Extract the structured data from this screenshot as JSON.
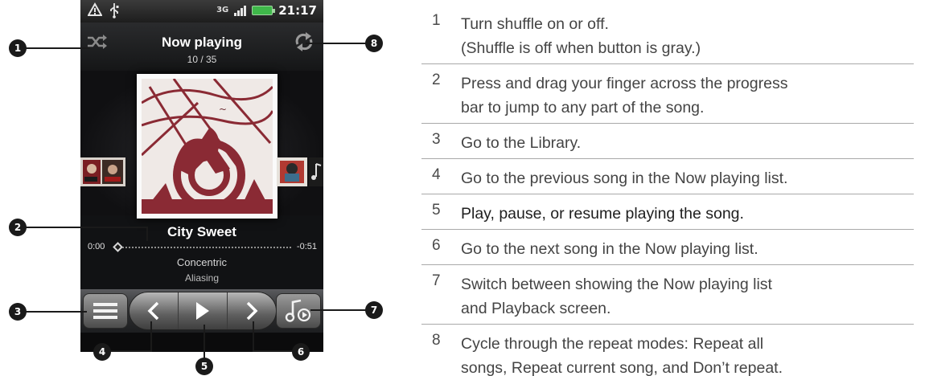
{
  "status_bar": {
    "network": "3G",
    "time": "21:17"
  },
  "player": {
    "header_title": "Now playing",
    "track_position": "10 / 35",
    "song_title": "City Sweet",
    "time_elapsed": "0:00",
    "time_remaining": "-0:51",
    "artist": "Concentric",
    "album": "Aliasing",
    "progress_fraction": 0.0,
    "shuffle_on": false
  },
  "icons": {
    "status_left": [
      "warning-icon",
      "usb-icon"
    ],
    "header": [
      "shuffle-icon",
      "repeat-icon"
    ],
    "controls": [
      "library-menu-icon",
      "previous-icon",
      "play-icon",
      "next-icon",
      "now-playing-list-icon"
    ]
  },
  "callouts": [
    "1",
    "2",
    "3",
    "4",
    "5",
    "6",
    "7",
    "8"
  ],
  "legend": [
    {
      "num": "1",
      "text": [
        "Turn shuffle on or off.",
        "(Shuffle is off when button is gray.)"
      ]
    },
    {
      "num": "2",
      "text": [
        "Press and drag your finger across the progress",
        "bar to jump to any part of the song."
      ]
    },
    {
      "num": "3",
      "text": [
        "Go to the Library."
      ]
    },
    {
      "num": "4",
      "text": [
        "Go to the previous song in the Now playing list."
      ]
    },
    {
      "num": "5",
      "text": [
        "Play, pause, or resume playing the song."
      ]
    },
    {
      "num": "6",
      "text": [
        "Go to the next song in the Now playing list."
      ]
    },
    {
      "num": "7",
      "text": [
        "Switch between showing the Now playing list",
        "and Playback screen."
      ]
    },
    {
      "num": "8",
      "text": [
        "Cycle through the repeat modes: Repeat all",
        "songs, Repeat current song, and Don’t repeat."
      ]
    }
  ],
  "colors": {
    "phone_background": "#111214",
    "callout": "#1a1a1a",
    "album_art_red": "#8a2a34",
    "divider": "#a9a9a9"
  }
}
